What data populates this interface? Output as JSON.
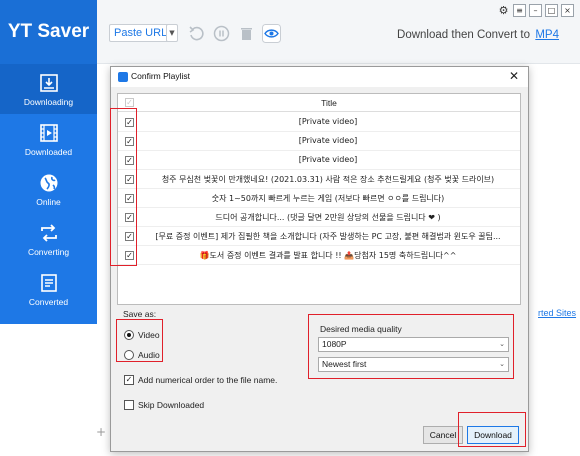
{
  "app": {
    "logo": "YT Saver",
    "nav": [
      {
        "label": "Downloading",
        "icon": "download-tray-icon",
        "active": true
      },
      {
        "label": "Downloaded",
        "icon": "film-icon",
        "active": false
      },
      {
        "label": "Online",
        "icon": "globe-icon",
        "active": false
      },
      {
        "label": "Converting",
        "icon": "convert-arrows-icon",
        "active": false
      },
      {
        "label": "Converted",
        "icon": "document-list-icon",
        "active": false
      }
    ],
    "toolbar": {
      "paste_url": "Paste URL",
      "convert_label": "Download then Convert to",
      "convert_format": "MP4"
    },
    "supported_sites_fragment": "rted Sites",
    "accent_color": "#1e78e6",
    "highlight_color": "#e0202a"
  },
  "dialog": {
    "title": "Confirm Playlist",
    "close_glyph": "✕",
    "column_title": "Title",
    "rows": [
      {
        "title": "[Private video]",
        "checked": true
      },
      {
        "title": "[Private video]",
        "checked": true
      },
      {
        "title": "[Private video]",
        "checked": true
      },
      {
        "title": "청주 무심천 벚꽃이 만개했네요! (2021.03.31) 사람 적은 장소 추천드릴게요 (청주 벚꽃 드라이브)",
        "checked": true
      },
      {
        "title": "숫자 1~50까지 빠르게 누르는 게임 (저보다 빠르면 ㅇㅇ를 드립니다)",
        "checked": true
      },
      {
        "title": "드디어 공개합니다... (댓글 달면 2만원 상당의 선물을 드립니다 ❤ )",
        "checked": true
      },
      {
        "title": "[무료 증정 이벤트] 제가 집필한 책을 소개합니다 (자주 발생하는 PC 고장, 불편 해결법과 윈도우 꿀팁...",
        "checked": true
      },
      {
        "title": "🎁도서 증정 이벤트 결과를 발표 합니다 !! 📤당첨자 15명 축하드립니다^^",
        "checked": true
      }
    ],
    "save_as_label": "Save as:",
    "save_as_options": [
      {
        "label": "Video",
        "selected": true
      },
      {
        "label": "Audio",
        "selected": false
      }
    ],
    "numerical_order_label": "Add numerical order to the file name.",
    "numerical_order_checked": true,
    "skip_downloaded_label": "Skip Downloaded",
    "skip_downloaded_checked": false,
    "quality_label": "Desired media quality",
    "quality_value": "1080P",
    "order_value": "Newest first",
    "cancel_label": "Cancel",
    "download_label": "Download"
  }
}
